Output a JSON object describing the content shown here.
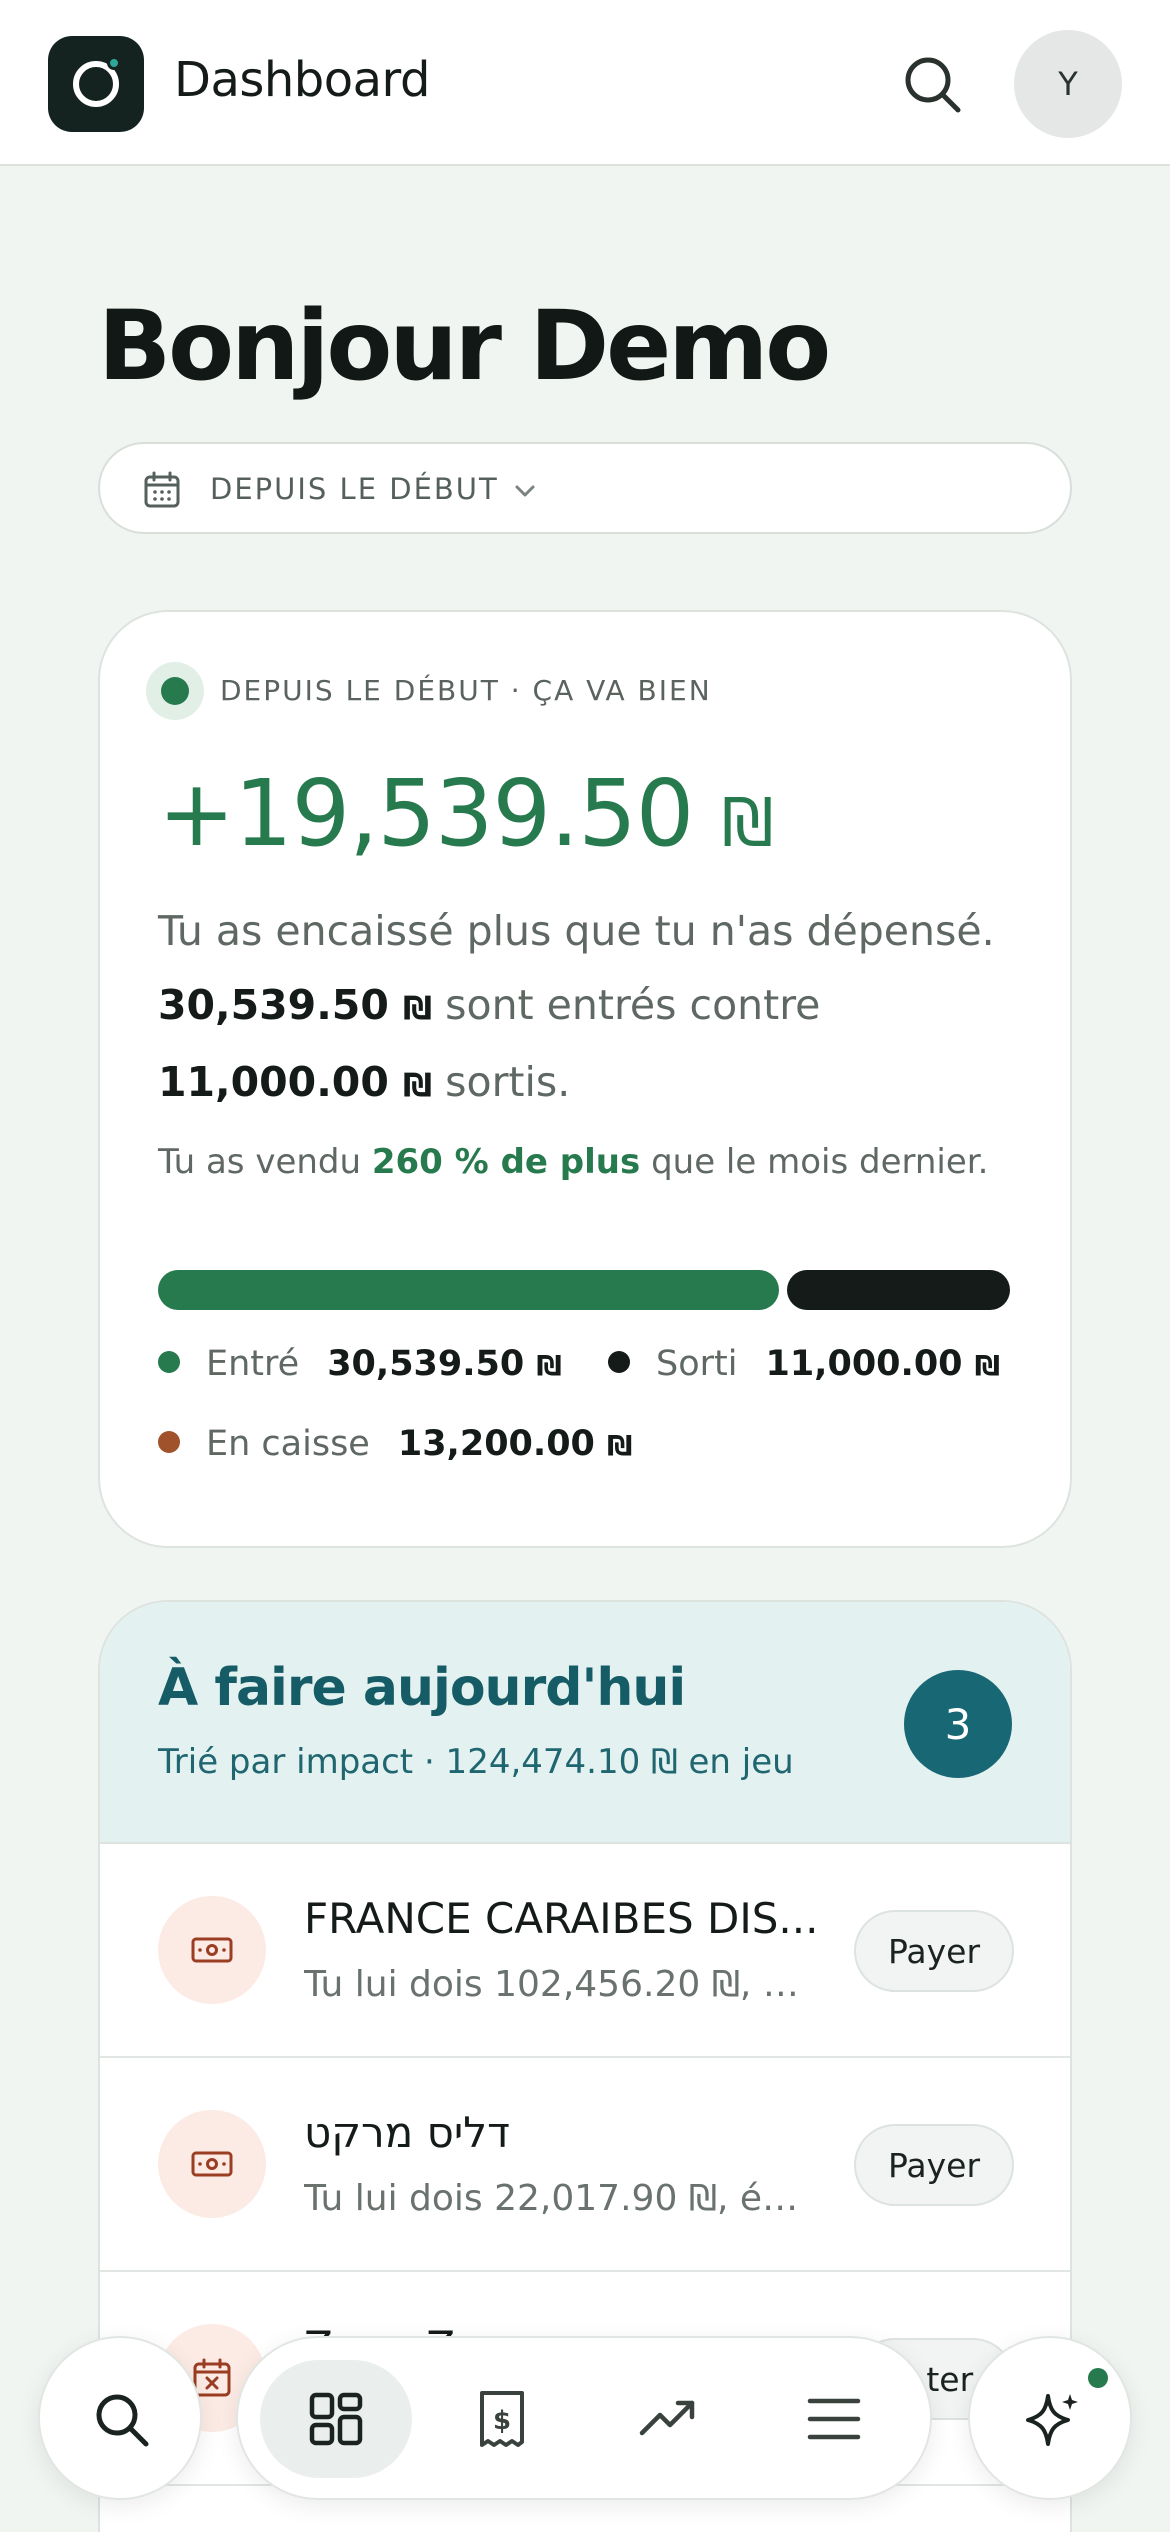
{
  "header": {
    "title": "Dashboard",
    "avatar_initial": "Y"
  },
  "greeting": "Bonjour Demo",
  "period": {
    "label": "DEPUIS LE DÉBUT"
  },
  "summary": {
    "status": "DEPUIS LE DÉBUT · ÇA VA BIEN",
    "net_amount": "+19,539.50",
    "currency": "₪",
    "line1": "Tu as encaissé plus que tu n'as dépensé.",
    "in_amount": "30,539.50",
    "mid_text": "sont entrés contre",
    "out_amount": "11,000.00",
    "end_text": "sortis.",
    "sales_prefix": "Tu as vendu",
    "sales_highlight": "260 % de plus",
    "sales_suffix": "que le mois dernier.",
    "bar_in_fraction": 0.7352,
    "legend": {
      "in_label": "Entré",
      "in_value": "30,539.50",
      "out_label": "Sorti",
      "out_value": "11,000.00",
      "cash_label": "En caisse",
      "cash_value": "13,200.00"
    }
  },
  "todo": {
    "title": "À faire aujourd'hui",
    "subtitle": "Trié par impact · 124,474.10 ₪ en jeu",
    "count": "3",
    "items": [
      {
        "title": "FRANCE CARAIBES DIS...",
        "subtitle": "Tu lui dois 102,456.20 ₪, éc...",
        "action": "Payer"
      },
      {
        "title": "דליס מרקט",
        "subtitle": "Tu lui dois 22,017.90 ₪, éch...",
        "action": "Payer"
      },
      {
        "title": "Z... ...Z",
        "subtitle": "",
        "action": "...ter"
      }
    ]
  },
  "colors": {
    "accent_green": "#277a4d",
    "dark": "#141b18",
    "cash_orange": "#a0532a",
    "teal": "#186774"
  },
  "icons": {
    "header_search": "search-icon",
    "period": "calendar-icon",
    "nav": [
      "search-icon",
      "dashboard-icon",
      "receipt-icon",
      "trend-icon",
      "menu-icon",
      "sparkle-icon"
    ]
  }
}
